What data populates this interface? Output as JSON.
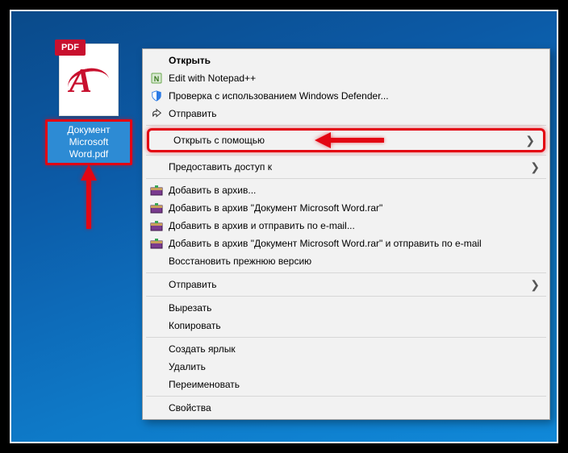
{
  "file": {
    "badge": "PDF",
    "name": "Документ Microsoft Word.pdf"
  },
  "menu": {
    "open": "Открыть",
    "edit_npp": "Edit with Notepad++",
    "defender": "Проверка с использованием Windows Defender...",
    "send_share": "Отправить",
    "open_with": "Открыть с помощью",
    "grant_access": "Предоставить доступ к",
    "rar_add": "Добавить в архив...",
    "rar_add_named": "Добавить в архив \"Документ Microsoft Word.rar\"",
    "rar_add_email": "Добавить в архив и отправить по e-mail...",
    "rar_add_named_email": "Добавить в архив \"Документ Microsoft Word.rar\" и отправить по e-mail",
    "restore": "Восстановить прежнюю версию",
    "send_to": "Отправить",
    "cut": "Вырезать",
    "copy": "Копировать",
    "shortcut": "Создать ярлык",
    "delete": "Удалить",
    "rename": "Переименовать",
    "properties": "Свойства"
  }
}
